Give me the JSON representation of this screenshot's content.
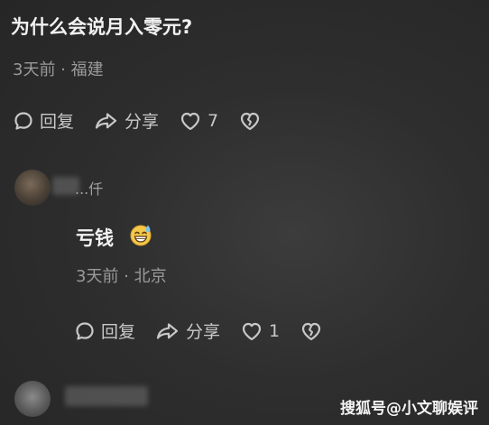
{
  "comment": {
    "text": "为什么会说月入零元?",
    "meta": "3天前 · 福建",
    "actions": {
      "reply_label": "回复",
      "share_label": "分享",
      "like_count": "7"
    }
  },
  "reply": {
    "username": "...仟",
    "text": "亏钱",
    "emoji": "grinning-sweat-emoji",
    "meta": "3天前 · 北京",
    "actions": {
      "reply_label": "回复",
      "share_label": "分享",
      "like_count": "1"
    }
  },
  "watermark": "搜狐号@小文聊娱评",
  "icons": {
    "reply": "comment-bubble-icon",
    "share": "share-arrow-icon",
    "like": "heart-icon",
    "dislike": "broken-heart-icon"
  },
  "colors": {
    "background": "#2e2e2e",
    "text_primary": "#f2f2f2",
    "text_secondary": "#9a9a9a",
    "icon": "#c8c8c8"
  }
}
